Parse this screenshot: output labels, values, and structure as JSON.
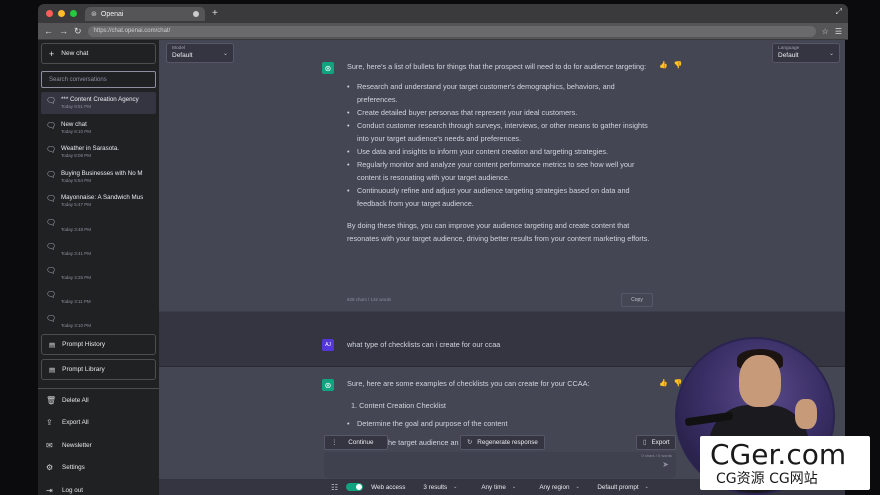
{
  "browser": {
    "tab_title": "Openai",
    "new_tab": "+",
    "url": "https://chat.openai.com/chat/",
    "colors": {
      "close": "#ff5f57",
      "minimize": "#febc2e",
      "maximize": "#28c840"
    }
  },
  "sidebar": {
    "new_chat": "New chat",
    "search_placeholder": "Search conversations",
    "conversations": [
      {
        "title": "*** Content Creation Agency",
        "date": "Today 9:51 PM"
      },
      {
        "title": "New chat",
        "date": "Today 8:10 PM"
      },
      {
        "title": "Weather in Sarasota.",
        "date": "Today 8:08 PM"
      },
      {
        "title": "Buying Businesses with No M",
        "date": "Today 5:54 PM"
      },
      {
        "title": "Mayonnaise: A Sandwich Mus",
        "date": "Today 5:47 PM"
      },
      {
        "title": "",
        "date": "Today 3:48 PM"
      },
      {
        "title": "",
        "date": "Today 3:41 PM"
      },
      {
        "title": "",
        "date": "Today 3:25 PM"
      },
      {
        "title": "",
        "date": "Today 3:11 PM"
      },
      {
        "title": "",
        "date": "Today 3:10 PM"
      }
    ],
    "prompt_history": "Prompt History",
    "prompt_library": "Prompt Library",
    "delete_all": "Delete All",
    "export_all": "Export All",
    "newsletter": "Newsletter",
    "settings": "Settings",
    "log_out": "Log out"
  },
  "header": {
    "model_label": "Model",
    "model_value": "Default",
    "language_label": "Language",
    "language_value": "Default"
  },
  "messages": {
    "ai1": {
      "intro": "Sure, here's a list of bullets for things that the prospect will need to do for audience targeting:",
      "bullets": [
        "Research and understand your target customer's demographics, behaviors, and preferences.",
        "Create detailed buyer personas that represent your ideal customers.",
        "Conduct customer research through surveys, interviews, or other means to gather insights into your target audience's needs and preferences.",
        "Use data and insights to inform your content creation and targeting strategies.",
        "Regularly monitor and analyze your content performance metrics to see how well your content is resonating with your target audience.",
        "Continuously refine and adjust your audience targeting strategies based on data and feedback from your target audience."
      ],
      "outro": "By doing these things, you can improve your audience targeting and create content that resonates with your target audience, driving better results from your content marketing efforts.",
      "meta": "828 chars / 132 words",
      "copy": "Copy"
    },
    "user": {
      "avatar": "AJ",
      "text": "what type of checklists can i create for our ccaa"
    },
    "ai2": {
      "intro": "Sure, here are some examples of checklists you can create for your CCAA:",
      "item1": "1.  Content Creation Checklist",
      "sub1": "Determine the goal and purpose of the content",
      "partial": "he target audience an"
    }
  },
  "controls": {
    "more": "⋮",
    "continue": "Continue",
    "regenerate": "Regenerate response",
    "export": "Export",
    "composer_count": "0 chars / 0 words",
    "web_access": "Web access",
    "results": "3 results",
    "time": "Any time",
    "region": "Any region",
    "prompt": "Default prompt"
  },
  "watermark": {
    "line1": "CGer.com",
    "line2": "CG资源 CG网站"
  }
}
